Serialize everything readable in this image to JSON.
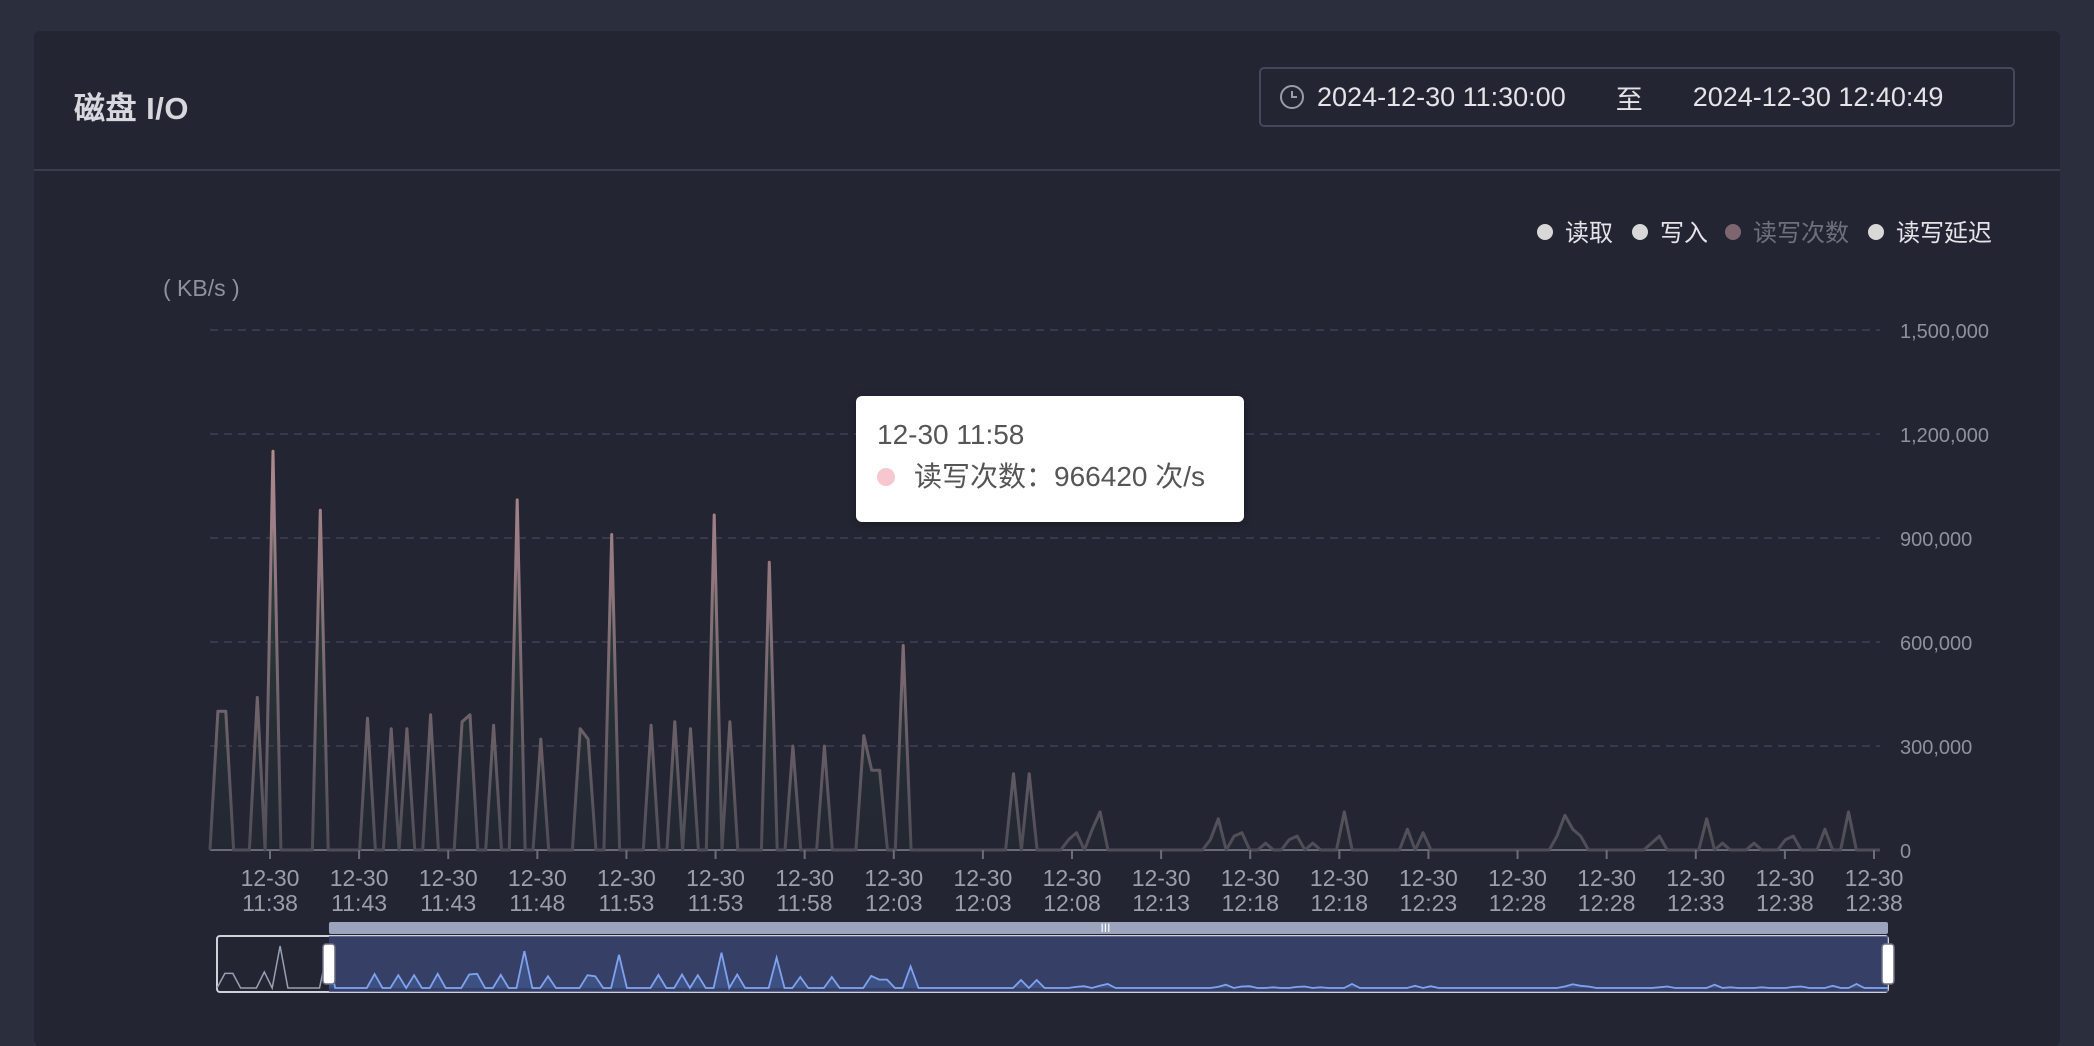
{
  "panel": {
    "title": "磁盘 I/O",
    "range_start": "2024-12-30 11:30:00",
    "range_separator": "至",
    "range_end": "2024-12-30 12:40:49"
  },
  "tooltip": {
    "time": "12-30 11:58",
    "series_name": "读写次数",
    "value": "966420",
    "unit": "次/s"
  },
  "chart_data": {
    "type": "line",
    "ylabel": "( KB/s )",
    "ylim": [
      0,
      1500000
    ],
    "y_ticks": [
      "1,500,000",
      "1,200,000",
      "900,000",
      "600,000",
      "300,000",
      "0"
    ],
    "x_ticks": [
      [
        "12-30",
        "11:38"
      ],
      [
        "12-30",
        "11:43"
      ],
      [
        "12-30",
        "11:43"
      ],
      [
        "12-30",
        "11:48"
      ],
      [
        "12-30",
        "11:53"
      ],
      [
        "12-30",
        "11:53"
      ],
      [
        "12-30",
        "11:58"
      ],
      [
        "12-30",
        "12:03"
      ],
      [
        "12-30",
        "12:03"
      ],
      [
        "12-30",
        "12:08"
      ],
      [
        "12-30",
        "12:13"
      ],
      [
        "12-30",
        "12:18"
      ],
      [
        "12-30",
        "12:18"
      ],
      [
        "12-30",
        "12:23"
      ],
      [
        "12-30",
        "12:28"
      ],
      [
        "12-30",
        "12:28"
      ],
      [
        "12-30",
        "12:33"
      ],
      [
        "12-30",
        "12:38"
      ],
      [
        "12-30",
        "12:38"
      ]
    ],
    "grid": true,
    "legend_position": "top-right",
    "legend": [
      {
        "name": "读取",
        "color": "#d8d8d8",
        "active": true
      },
      {
        "name": "写入",
        "color": "#d8d8d8",
        "active": true
      },
      {
        "name": "读写次数",
        "color": "#7d6670",
        "active": false
      },
      {
        "name": "读写延迟",
        "color": "#d8d8d8",
        "active": true
      }
    ],
    "series": [
      {
        "name": "读写次数",
        "color": "#8a6e72",
        "values": [
          0,
          400000,
          400000,
          0,
          0,
          0,
          440000,
          0,
          1150000,
          0,
          0,
          0,
          0,
          0,
          980000,
          0,
          0,
          0,
          0,
          0,
          380000,
          0,
          0,
          350000,
          0,
          350000,
          0,
          0,
          390000,
          0,
          0,
          0,
          370000,
          390000,
          0,
          0,
          360000,
          0,
          0,
          1010000,
          0,
          0,
          320000,
          0,
          0,
          0,
          0,
          350000,
          320000,
          0,
          0,
          910000,
          0,
          0,
          0,
          0,
          360000,
          0,
          0,
          370000,
          0,
          350000,
          0,
          0,
          966420,
          0,
          370000,
          0,
          0,
          0,
          0,
          830000,
          0,
          0,
          300000,
          0,
          0,
          0,
          300000,
          0,
          0,
          0,
          0,
          330000,
          230000,
          230000,
          0,
          0,
          590000,
          0,
          0,
          0,
          0,
          0,
          0,
          0,
          0,
          0,
          0,
          0,
          0,
          0,
          220000,
          0,
          220000,
          0,
          0,
          0,
          0,
          30000,
          50000,
          0,
          60000,
          110000,
          0,
          0,
          0,
          0,
          0,
          0,
          0,
          0,
          0,
          0,
          0,
          0,
          0,
          30000,
          90000,
          0,
          40000,
          50000,
          0,
          0,
          20000,
          0,
          0,
          30000,
          40000,
          0,
          20000,
          0,
          0,
          0,
          110000,
          0,
          0,
          0,
          0,
          0,
          0,
          0,
          60000,
          0,
          50000,
          0,
          0,
          0,
          0,
          0,
          0,
          0,
          0,
          0,
          0,
          0,
          0,
          0,
          0,
          0,
          0,
          40000,
          100000,
          60000,
          40000,
          0,
          0,
          0,
          0,
          0,
          0,
          0,
          0,
          20000,
          40000,
          0,
          0,
          0,
          0,
          0,
          90000,
          0,
          20000,
          0,
          0,
          0,
          20000,
          0,
          0,
          0,
          30000,
          40000,
          0,
          0,
          0,
          60000,
          0,
          0,
          110000,
          0,
          0,
          0,
          0
        ]
      }
    ],
    "data_zoom": {
      "start_fraction": 0.067,
      "end_fraction": 1.0
    }
  }
}
